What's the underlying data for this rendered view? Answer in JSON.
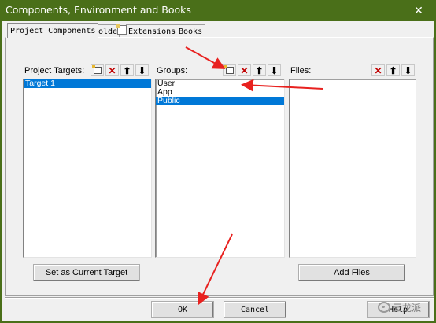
{
  "window": {
    "title": "Components, Environment and Books",
    "close_glyph": "✕"
  },
  "tabs": [
    {
      "label": "Project Components",
      "active": true
    },
    {
      "label": "Folde",
      "active": false
    },
    {
      "label": "Extensions",
      "active": false
    },
    {
      "label": "Books",
      "active": false
    }
  ],
  "panels": {
    "targets": {
      "title": "Project Targets:",
      "items": [
        {
          "label": "Target 1",
          "selected": true
        }
      ],
      "button": "Set as Current Target"
    },
    "groups": {
      "title": "Groups:",
      "items": [
        {
          "label": "User",
          "selected": false
        },
        {
          "label": "App",
          "selected": false
        },
        {
          "label": "Public",
          "selected": true
        }
      ]
    },
    "files": {
      "title": "Files:",
      "items": [],
      "button": "Add Files"
    }
  },
  "toolbar_glyphs": {
    "delete": "✕",
    "move_up": "⬆",
    "move_down": "⬇"
  },
  "footer": {
    "ok": "OK",
    "cancel": "Cancel",
    "help": "Help"
  },
  "watermark": {
    "text": "云龙派"
  },
  "colors": {
    "titlebar": "#4a6f19",
    "selection": "#0078d7",
    "annotation_arrow": "#e8211f",
    "delete_icon": "#c00000"
  }
}
